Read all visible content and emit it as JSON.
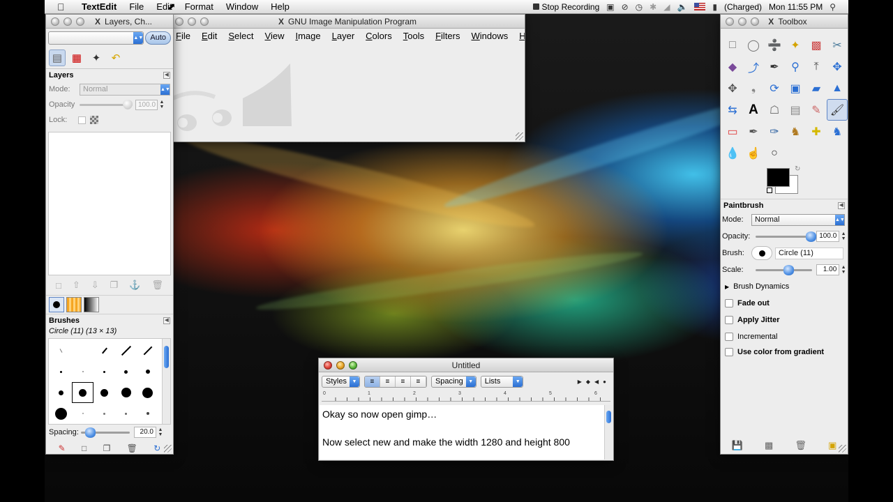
{
  "menubar": {
    "app_name": "TextEdit",
    "items": [
      "File",
      "Edit",
      "Format",
      "Window",
      "Help"
    ],
    "stop_recording": "Stop Recording",
    "battery": "(Charged)",
    "clock": "Mon 11:55 PM"
  },
  "gimp": {
    "title": "GNU Image Manipulation Program",
    "menu": [
      "File",
      "Edit",
      "Select",
      "View",
      "Image",
      "Layer",
      "Colors",
      "Tools",
      "Filters",
      "Windows",
      "Help"
    ]
  },
  "layers_dock": {
    "title": "Layers, Ch...",
    "auto_button": "Auto",
    "layers_section": "Layers",
    "mode_label": "Mode:",
    "mode_value": "Normal",
    "opacity_label": "Opacity",
    "opacity_value": "100.0",
    "lock_label": "Lock:",
    "brushes_section": "Brushes",
    "brush_name": "Circle (11) (13 × 13)",
    "spacing_label": "Spacing:",
    "spacing_value": "20.0"
  },
  "toolbox": {
    "title": "Toolbox",
    "tool_options_title": "Paintbrush",
    "mode_label": "Mode:",
    "mode_value": "Normal",
    "opacity_label": "Opacity:",
    "opacity_value": "100.0",
    "brush_label": "Brush:",
    "brush_value": "Circle (11)",
    "scale_label": "Scale:",
    "scale_value": "1.00",
    "brush_dynamics": "Brush Dynamics",
    "fade_out": "Fade out",
    "apply_jitter": "Apply Jitter",
    "incremental": "Incremental",
    "use_color_from_gradient": "Use color from gradient"
  },
  "textedit": {
    "title": "Untitled",
    "styles": "Styles",
    "spacing": "Spacing",
    "lists": "Lists",
    "ruler_labels": [
      "0",
      "1",
      "2",
      "3",
      "4",
      "5",
      "6"
    ],
    "line1": "Okay so now open gimp…",
    "line2": "Now select new and make the width 1280 and height 800"
  }
}
